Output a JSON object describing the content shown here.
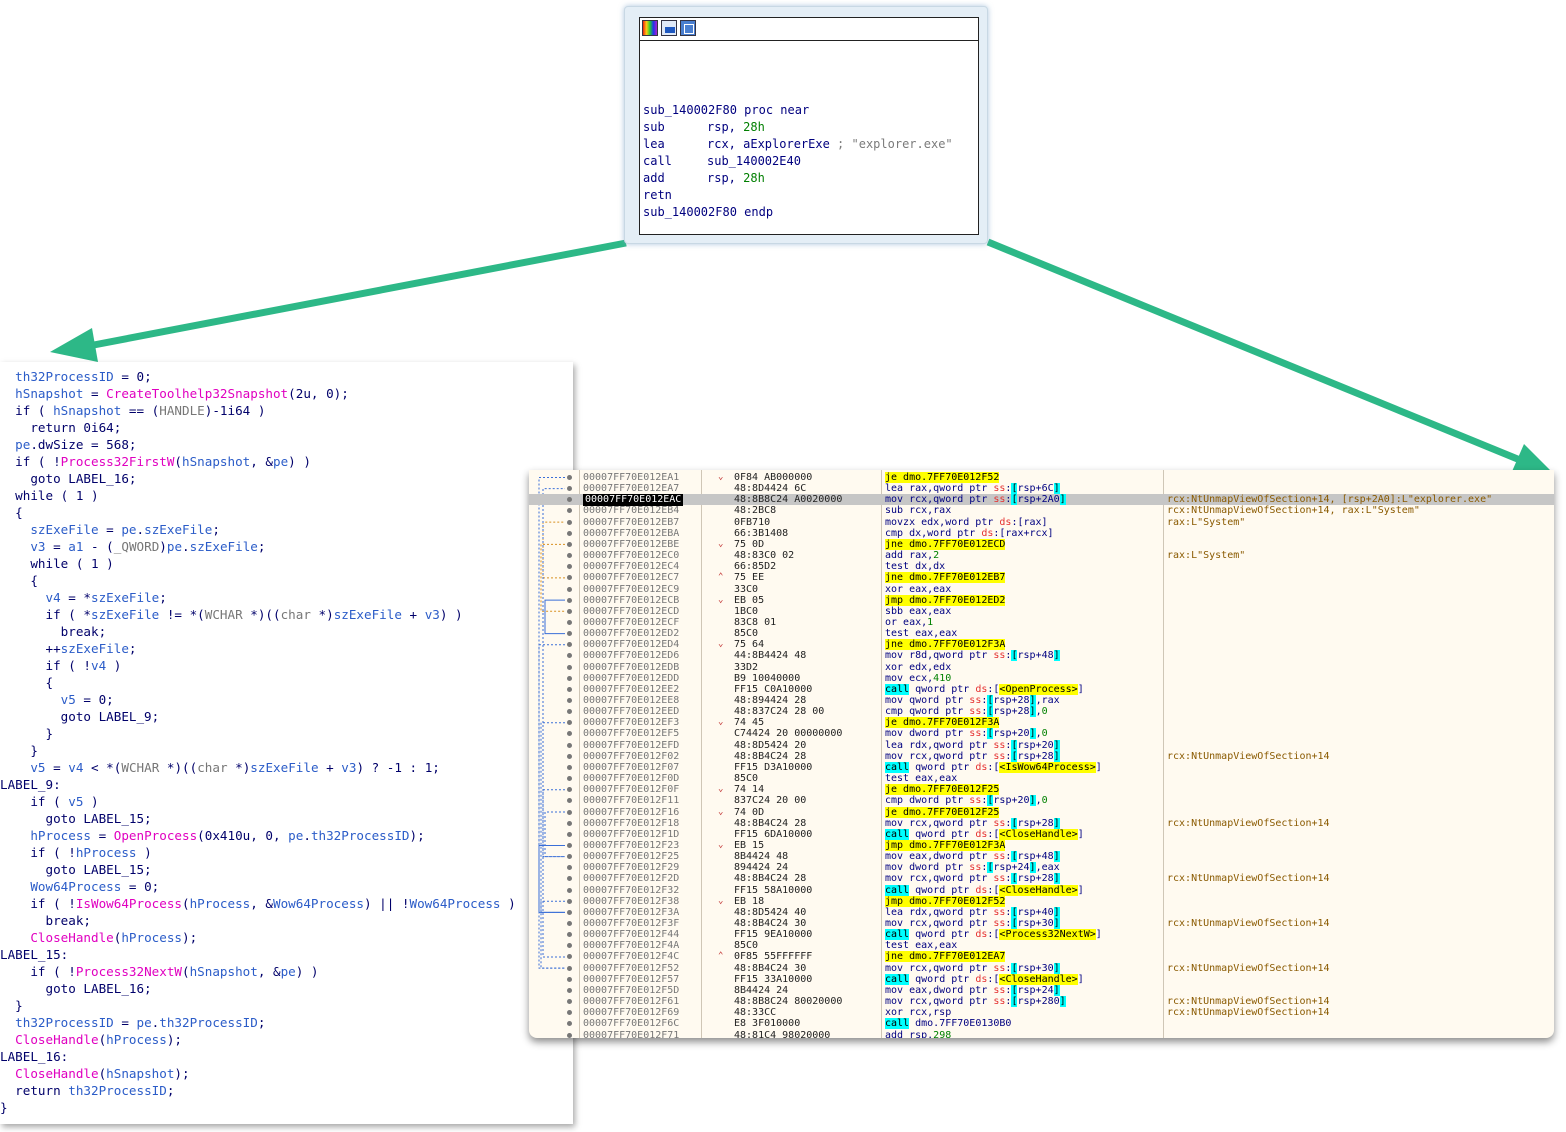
{
  "ida_node": {
    "lines": [
      {
        "mn": "sub_140002F80 proc near",
        "op": "",
        "cmt": ""
      },
      {
        "mn": "sub",
        "op": "rsp, 28h",
        "cmt": ""
      },
      {
        "mn": "lea",
        "op": "rcx, aExplorerExe",
        "cmt": "; \"explorer.exe\""
      },
      {
        "mn": "call",
        "op": "sub_140002E40",
        "cmt": ""
      },
      {
        "mn": "add",
        "op": "rsp, 28h",
        "cmt": ""
      },
      {
        "mn": "retn",
        "op": "",
        "cmt": ""
      },
      {
        "mn": "sub_140002F80 endp",
        "op": "",
        "cmt": ""
      }
    ],
    "toolbar_icons": [
      "color-palette-icon",
      "edit-node-icon",
      "graph-view-icon"
    ]
  },
  "colors": {
    "arrow": "#2db887",
    "pseudo_var": "#2b5cc8",
    "pseudo_func": "#e000c0",
    "selected_row": "#000000"
  },
  "pseudocode": [
    "  th32ProcessID = 0;",
    "  hSnapshot = CreateToolhelp32Snapshot(2u, 0);",
    "  if ( hSnapshot == (HANDLE)-1i64 )",
    "    return 0i64;",
    "  pe.dwSize = 568;",
    "  if ( !Process32FirstW(hSnapshot, &pe) )",
    "    goto LABEL_16;",
    "  while ( 1 )",
    "  {",
    "    szExeFile = pe.szExeFile;",
    "    v3 = a1 - (_QWORD)pe.szExeFile;",
    "    while ( 1 )",
    "    {",
    "      v4 = *szExeFile;",
    "      if ( *szExeFile != *(WCHAR *)((char *)szExeFile + v3) )",
    "        break;",
    "      ++szExeFile;",
    "      if ( !v4 )",
    "      {",
    "        v5 = 0;",
    "        goto LABEL_9;",
    "      }",
    "    }",
    "    v5 = v4 < *(WCHAR *)((char *)szExeFile + v3) ? -1 : 1;",
    "LABEL_9:",
    "    if ( v5 )",
    "      goto LABEL_15;",
    "    hProcess = OpenProcess(0x410u, 0, pe.th32ProcessID);",
    "    if ( !hProcess )",
    "      goto LABEL_15;",
    "    Wow64Process = 0;",
    "    if ( !IsWow64Process(hProcess, &Wow64Process) || !Wow64Process )",
    "      break;",
    "    CloseHandle(hProcess);",
    "LABEL_15:",
    "    if ( !Process32NextW(hSnapshot, &pe) )",
    "      goto LABEL_16;",
    "  }",
    "  th32ProcessID = pe.th32ProcessID;",
    "  CloseHandle(hProcess);",
    "LABEL_16:",
    "  CloseHandle(hSnapshot);",
    "  return th32ProcessID;",
    "}"
  ],
  "disasm": [
    {
      "addr": "00007FF70E012EA1",
      "arrow": "v",
      "bytes": "0F84 AB000000",
      "ins": "je dmo.7FF70E012F52",
      "cmt": ""
    },
    {
      "addr": "00007FF70E012EA7",
      "arrow": "",
      "bytes": "48:8D4424 6C",
      "ins": "lea rax,qword ptr ss:[rsp+6C]",
      "cmt": ""
    },
    {
      "addr": "00007FF70E012EAC",
      "arrow": "",
      "bytes": "48:8B8C24 A0020000",
      "ins": "mov rcx,qword ptr ss:[rsp+2A0]",
      "cmt": "rcx:NtUnmapViewOfSection+14, [rsp+2A0]:L\"explorer.exe\"",
      "sel": true
    },
    {
      "addr": "00007FF70E012EB4",
      "arrow": "",
      "bytes": "48:2BC8",
      "ins": "sub rcx,rax",
      "cmt": "rcx:NtUnmapViewOfSection+14, rax:L\"System\""
    },
    {
      "addr": "00007FF70E012EB7",
      "arrow": "",
      "bytes": "0FB710",
      "ins": "movzx edx,word ptr ds:[rax]",
      "cmt": "rax:L\"System\""
    },
    {
      "addr": "00007FF70E012EBA",
      "arrow": "",
      "bytes": "66:3B1408",
      "ins": "cmp dx,word ptr ds:[rax+rcx]",
      "cmt": ""
    },
    {
      "addr": "00007FF70E012EBE",
      "arrow": "v",
      "bytes": "75 0D",
      "ins": "jne dmo.7FF70E012ECD",
      "cmt": ""
    },
    {
      "addr": "00007FF70E012EC0",
      "arrow": "",
      "bytes": "48:83C0 02",
      "ins": "add rax,2",
      "cmt": "rax:L\"System\""
    },
    {
      "addr": "00007FF70E012EC4",
      "arrow": "",
      "bytes": "66:85D2",
      "ins": "test dx,dx",
      "cmt": ""
    },
    {
      "addr": "00007FF70E012EC7",
      "arrow": "^",
      "bytes": "75 EE",
      "ins": "jne dmo.7FF70E012EB7",
      "cmt": ""
    },
    {
      "addr": "00007FF70E012EC9",
      "arrow": "",
      "bytes": "33C0",
      "ins": "xor eax,eax",
      "cmt": ""
    },
    {
      "addr": "00007FF70E012ECB",
      "arrow": "v",
      "bytes": "EB 05",
      "ins": "jmp dmo.7FF70E012ED2",
      "cmt": ""
    },
    {
      "addr": "00007FF70E012ECD",
      "arrow": "",
      "bytes": "1BC0",
      "ins": "sbb eax,eax",
      "cmt": ""
    },
    {
      "addr": "00007FF70E012ECF",
      "arrow": "",
      "bytes": "83C8 01",
      "ins": "or eax,1",
      "cmt": ""
    },
    {
      "addr": "00007FF70E012ED2",
      "arrow": "",
      "bytes": "85C0",
      "ins": "test eax,eax",
      "cmt": ""
    },
    {
      "addr": "00007FF70E012ED4",
      "arrow": "v",
      "bytes": "75 64",
      "ins": "jne dmo.7FF70E012F3A",
      "cmt": ""
    },
    {
      "addr": "00007FF70E012ED6",
      "arrow": "",
      "bytes": "44:8B4424 48",
      "ins": "mov r8d,qword ptr ss:[rsp+48]",
      "cmt": ""
    },
    {
      "addr": "00007FF70E012EDB",
      "arrow": "",
      "bytes": "33D2",
      "ins": "xor edx,edx",
      "cmt": ""
    },
    {
      "addr": "00007FF70E012EDD",
      "arrow": "",
      "bytes": "B9 10040000",
      "ins": "mov ecx,410",
      "cmt": ""
    },
    {
      "addr": "00007FF70E012EE2",
      "arrow": "",
      "bytes": "FF15 C0A10000",
      "ins": "call qword ptr ds:[<OpenProcess>]",
      "cmt": ""
    },
    {
      "addr": "00007FF70E012EE8",
      "arrow": "",
      "bytes": "48:894424 28",
      "ins": "mov qword ptr ss:[rsp+28],rax",
      "cmt": ""
    },
    {
      "addr": "00007FF70E012EED",
      "arrow": "",
      "bytes": "48:837C24 28 00",
      "ins": "cmp qword ptr ss:[rsp+28],0",
      "cmt": ""
    },
    {
      "addr": "00007FF70E012EF3",
      "arrow": "v",
      "bytes": "74 45",
      "ins": "je dmo.7FF70E012F3A",
      "cmt": ""
    },
    {
      "addr": "00007FF70E012EF5",
      "arrow": "",
      "bytes": "C74424 20 00000000",
      "ins": "mov dword ptr ss:[rsp+20],0",
      "cmt": ""
    },
    {
      "addr": "00007FF70E012EFD",
      "arrow": "",
      "bytes": "48:8D5424 20",
      "ins": "lea rdx,qword ptr ss:[rsp+20]",
      "cmt": ""
    },
    {
      "addr": "00007FF70E012F02",
      "arrow": "",
      "bytes": "48:8B4C24 28",
      "ins": "mov rcx,qword ptr ss:[rsp+28]",
      "cmt": "rcx:NtUnmapViewOfSection+14"
    },
    {
      "addr": "00007FF70E012F07",
      "arrow": "",
      "bytes": "FF15 D3A10000",
      "ins": "call qword ptr ds:[<IsWow64Process>]",
      "cmt": ""
    },
    {
      "addr": "00007FF70E012F0D",
      "arrow": "",
      "bytes": "85C0",
      "ins": "test eax,eax",
      "cmt": ""
    },
    {
      "addr": "00007FF70E012F0F",
      "arrow": "v",
      "bytes": "74 14",
      "ins": "je dmo.7FF70E012F25",
      "cmt": ""
    },
    {
      "addr": "00007FF70E012F11",
      "arrow": "",
      "bytes": "837C24 20 00",
      "ins": "cmp dword ptr ss:[rsp+20],0",
      "cmt": ""
    },
    {
      "addr": "00007FF70E012F16",
      "arrow": "v",
      "bytes": "74 0D",
      "ins": "je dmo.7FF70E012F25",
      "cmt": ""
    },
    {
      "addr": "00007FF70E012F18",
      "arrow": "",
      "bytes": "48:8B4C24 28",
      "ins": "mov rcx,qword ptr ss:[rsp+28]",
      "cmt": "rcx:NtUnmapViewOfSection+14"
    },
    {
      "addr": "00007FF70E012F1D",
      "arrow": "",
      "bytes": "FF15 6DA10000",
      "ins": "call qword ptr ds:[<CloseHandle>]",
      "cmt": ""
    },
    {
      "addr": "00007FF70E012F23",
      "arrow": "v",
      "bytes": "EB 15",
      "ins": "jmp dmo.7FF70E012F3A",
      "cmt": ""
    },
    {
      "addr": "00007FF70E012F25",
      "arrow": "",
      "bytes": "8B4424 48",
      "ins": "mov eax,dword ptr ss:[rsp+48]",
      "cmt": ""
    },
    {
      "addr": "00007FF70E012F29",
      "arrow": "",
      "bytes": "894424 24",
      "ins": "mov dword ptr ss:[rsp+24],eax",
      "cmt": ""
    },
    {
      "addr": "00007FF70E012F2D",
      "arrow": "",
      "bytes": "48:8B4C24 28",
      "ins": "mov rcx,qword ptr ss:[rsp+28]",
      "cmt": "rcx:NtUnmapViewOfSection+14"
    },
    {
      "addr": "00007FF70E012F32",
      "arrow": "",
      "bytes": "FF15 58A10000",
      "ins": "call qword ptr ds:[<CloseHandle>]",
      "cmt": ""
    },
    {
      "addr": "00007FF70E012F38",
      "arrow": "v",
      "bytes": "EB 18",
      "ins": "jmp dmo.7FF70E012F52",
      "cmt": ""
    },
    {
      "addr": "00007FF70E012F3A",
      "arrow": "",
      "bytes": "48:8D5424 40",
      "ins": "lea rdx,qword ptr ss:[rsp+40]",
      "cmt": ""
    },
    {
      "addr": "00007FF70E012F3F",
      "arrow": "",
      "bytes": "48:8B4C24 30",
      "ins": "mov rcx,qword ptr ss:[rsp+30]",
      "cmt": "rcx:NtUnmapViewOfSection+14"
    },
    {
      "addr": "00007FF70E012F44",
      "arrow": "",
      "bytes": "FF15 9EA10000",
      "ins": "call qword ptr ds:[<Process32NextW>]",
      "cmt": ""
    },
    {
      "addr": "00007FF70E012F4A",
      "arrow": "",
      "bytes": "85C0",
      "ins": "test eax,eax",
      "cmt": ""
    },
    {
      "addr": "00007FF70E012F4C",
      "arrow": "^",
      "bytes": "0F85 55FFFFFF",
      "ins": "jne dmo.7FF70E012EA7",
      "cmt": ""
    },
    {
      "addr": "00007FF70E012F52",
      "arrow": "",
      "bytes": "48:8B4C24 30",
      "ins": "mov rcx,qword ptr ss:[rsp+30]",
      "cmt": "rcx:NtUnmapViewOfSection+14"
    },
    {
      "addr": "00007FF70E012F57",
      "arrow": "",
      "bytes": "FF15 33A10000",
      "ins": "call qword ptr ds:[<CloseHandle>]",
      "cmt": ""
    },
    {
      "addr": "00007FF70E012F5D",
      "arrow": "",
      "bytes": "8B4424 24",
      "ins": "mov eax,dword ptr ss:[rsp+24]",
      "cmt": ""
    },
    {
      "addr": "00007FF70E012F61",
      "arrow": "",
      "bytes": "48:8B8C24 80020000",
      "ins": "mov rcx,qword ptr ss:[rsp+280]",
      "cmt": "rcx:NtUnmapViewOfSection+14"
    },
    {
      "addr": "00007FF70E012F69",
      "arrow": "",
      "bytes": "48:33CC",
      "ins": "xor rcx,rsp",
      "cmt": "rcx:NtUnmapViewOfSection+14"
    },
    {
      "addr": "00007FF70E012F6C",
      "arrow": "",
      "bytes": "E8 3F010000",
      "ins": "call dmo.7FF70E0130B0",
      "cmt": ""
    },
    {
      "addr": "00007FF70E012F71",
      "arrow": "",
      "bytes": "48:81C4 98020000",
      "ins": "add rsp,298",
      "cmt": ""
    }
  ]
}
